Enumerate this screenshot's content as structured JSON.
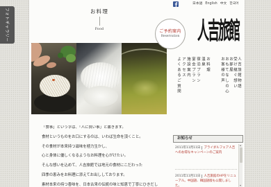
{
  "side_tab": {
    "label": "フォトギャラリー"
  },
  "header": {
    "page_title": "お料理",
    "page_subtitle": "Food",
    "reservation_label": "ご予約案内",
    "reservation_sublabel": "Reservation",
    "facebook_icon": "facebook-icon",
    "languages": [
      "日本語",
      "English",
      "中文",
      "한국어"
    ],
    "logo": "人吉旅館"
  },
  "nav": {
    "main": [
      "お料理",
      "温泉",
      "宿泊プラン",
      "宴会プラン",
      "施設案内",
      "アクセス",
      "よくあるご質問"
    ],
    "story": [
      "人吉旅館物語",
      "受け継ぐ想い",
      "お部屋",
      "おもてなしの心",
      "お客様の声"
    ]
  },
  "body_text": [
    "「食事」という字は、「人に良い事」と書きます。",
    "食材というものをお口にするのは、いわば生命を頂くこと。",
    "その食材が本来持つ滋味を極力生かし、",
    "心と身体に優しくなるようなお料理を心がけたい。",
    "そんな想いを込めて、人吉旅館では地元の食材にこだわった",
    "四季の恵みをお料理に添えてお出ししております。",
    "素材本来の持つ香味を、日本古来の伝統の味と知恵で丁寧にひきだし"
  ],
  "news": {
    "title": "お知らせ",
    "items": [
      {
        "date": "2011年11月11日",
        "text": "ブライダルフェア人吉へのお得なキャンペーンのご案内"
      },
      {
        "date": "2011年11月11日",
        "text": "人吉旅館のHPをリニューアル。中国語、韓国語版も公開しました。"
      }
    ]
  },
  "colors": {
    "accent": "#b3362c",
    "facebook": "#3b5998",
    "tab": "#555555",
    "background": "#e4e3de"
  }
}
